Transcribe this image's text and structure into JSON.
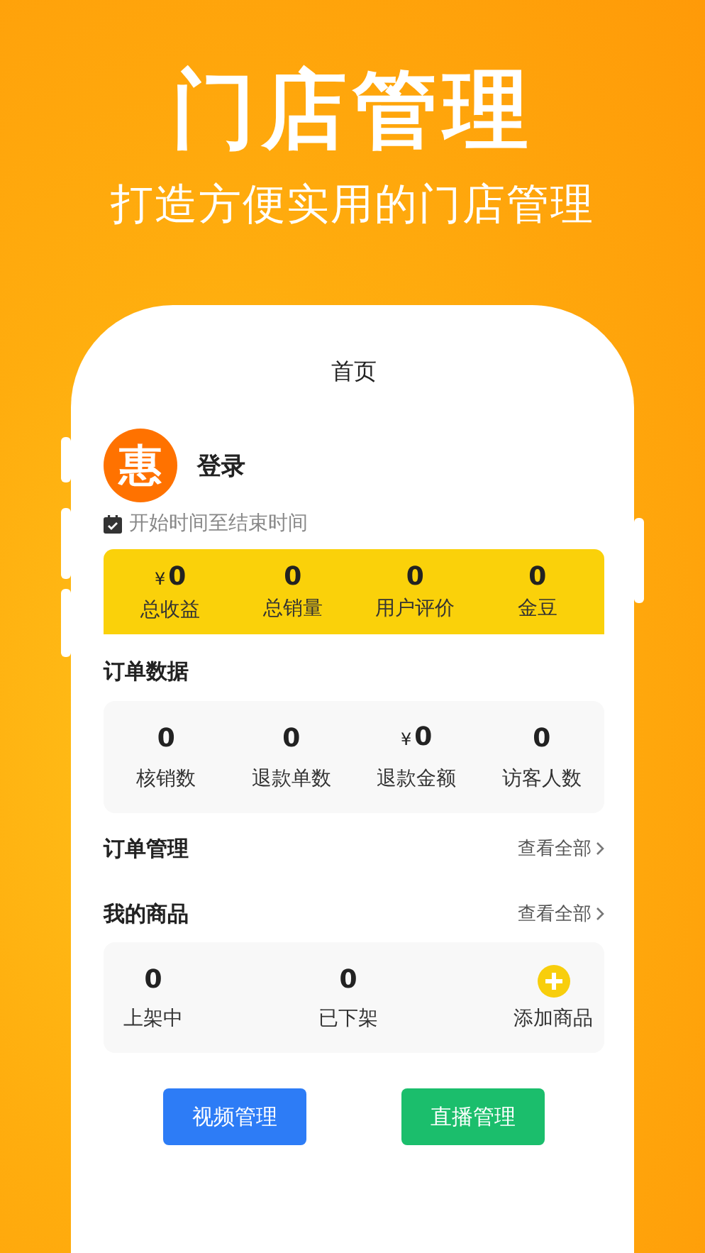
{
  "headline": "门店管理",
  "subtitle": "打造方便实用的门店管理",
  "screen": {
    "title": "首页",
    "logo_text": "惠",
    "login": "登录",
    "date_range": "开始时间至结束时间",
    "summary": [
      {
        "prefix": "¥",
        "value": "0",
        "label": "总收益"
      },
      {
        "value": "0",
        "label": "总销量"
      },
      {
        "value": "0",
        "label": "用户评价"
      },
      {
        "value": "0",
        "label": "金豆"
      }
    ],
    "order_data": {
      "title": "订单数据",
      "stats": [
        {
          "value": "0",
          "label": "核销数"
        },
        {
          "value": "0",
          "label": "退款单数"
        },
        {
          "prefix": "¥",
          "value": "0",
          "label": "退款金额"
        },
        {
          "value": "0",
          "label": "访客人数"
        }
      ]
    },
    "order_management": {
      "title": "订单管理",
      "link": "查看全部"
    },
    "my_products": {
      "title": "我的商品",
      "link": "查看全部",
      "items": [
        {
          "kind": "count",
          "value": "0",
          "label": "上架中"
        },
        {
          "kind": "count",
          "value": "0",
          "label": "已下架"
        },
        {
          "kind": "add",
          "label": "添加商品"
        }
      ]
    },
    "buttons": [
      {
        "label": "视频管理",
        "color": "#2d7cf6"
      },
      {
        "label": "直播管理",
        "color": "#1bbe6c"
      }
    ]
  }
}
